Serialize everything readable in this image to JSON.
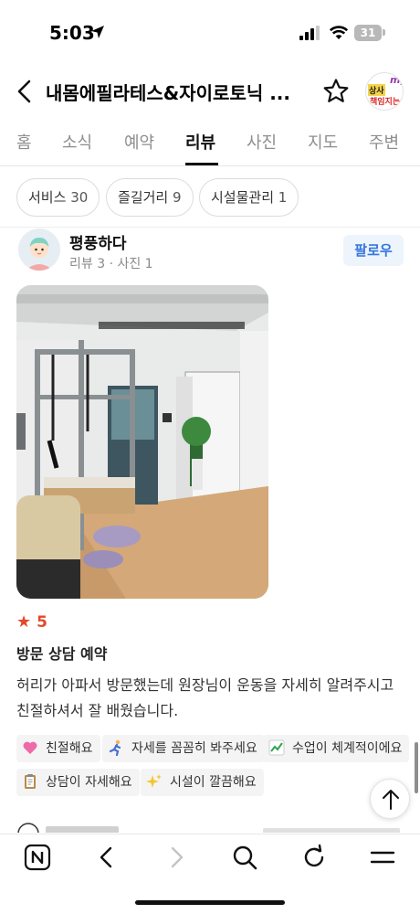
{
  "status_bar": {
    "time": "5:03",
    "battery": "31"
  },
  "header": {
    "title": "내몸에필라테스&자이로토닉 ..."
  },
  "avatar_top": {
    "line1": "my",
    "line2": "상사",
    "line3": "책임지는"
  },
  "tabs": [
    {
      "label": "홈"
    },
    {
      "label": "소식"
    },
    {
      "label": "예약"
    },
    {
      "label": "리뷰",
      "active": true
    },
    {
      "label": "사진"
    },
    {
      "label": "지도"
    },
    {
      "label": "주변"
    }
  ],
  "filters": [
    {
      "label": "서비스",
      "count": "30"
    },
    {
      "label": "즐길거리",
      "count": "9"
    },
    {
      "label": "시설물관리",
      "count": "1"
    }
  ],
  "review": {
    "author": "평풍하다",
    "meta": "리뷰 3 · 사진 1",
    "follow_label": "팔로우",
    "rating": "5",
    "visit_type": "방문 상담 예약",
    "text": "허리가 아파서 방문했는데 원장님이 운동을 자세히 알려주시고 친절하셔서 잘 배웠습니다.",
    "tags": [
      {
        "icon": "heart-emoji-icon",
        "label": "친절해요"
      },
      {
        "icon": "runner-emoji-icon",
        "label": "자세를 꼼꼼히 봐주세요"
      },
      {
        "icon": "chart-emoji-icon",
        "label": "수업이 체계적이에요"
      },
      {
        "icon": "clipboard-emoji-icon",
        "label": "상담이 자세해요"
      },
      {
        "icon": "sparkles-emoji-icon",
        "label": "시설이 깔끔해요"
      }
    ]
  },
  "colors": {
    "accent_blue": "#3576dc",
    "follow_bg": "#edf4fc",
    "rating_red": "#e04a2b",
    "tab_active": "#111111",
    "tab_inactive": "#8e8e8e"
  }
}
